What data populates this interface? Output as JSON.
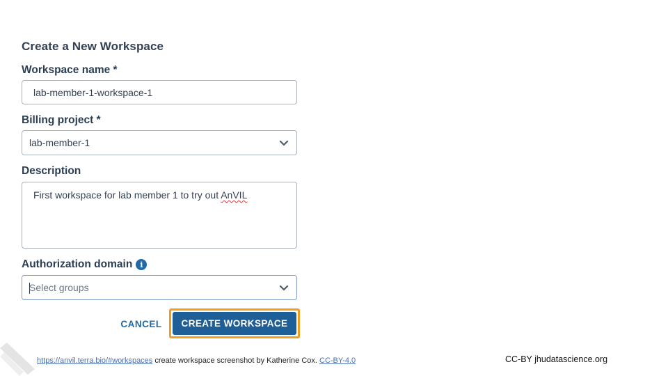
{
  "form": {
    "title": "Create a New Workspace",
    "workspace_name": {
      "label": "Workspace name *",
      "value": "lab-member-1-workspace-1"
    },
    "billing_project": {
      "label": "Billing project *",
      "value": "lab-member-1",
      "icon": "chevron-down-icon"
    },
    "description": {
      "label": "Description",
      "value_before": "First workspace for lab member 1 to try out ",
      "value_flagged": "AnVIL"
    },
    "authorization_domain": {
      "label": "Authorization domain",
      "info_icon": "info-icon",
      "info_glyph": "i",
      "placeholder": "Select groups",
      "icon": "chevron-down-icon"
    },
    "actions": {
      "cancel_label": "CANCEL",
      "create_label": "CREATE WORKSPACE"
    }
  },
  "footer": {
    "source_link": "https://anvil.terra.bio/#workspaces",
    "caption": " create workspace screenshot by Katherine Cox. ",
    "license_link": "CC-BY-4.0",
    "right_text": "CC-BY  jhudatascience.org"
  },
  "colors": {
    "primary_button": "#1e5f98",
    "highlight_outline": "#f39c1f",
    "link": "#1f6aa8",
    "label_text": "#2c3e54"
  }
}
